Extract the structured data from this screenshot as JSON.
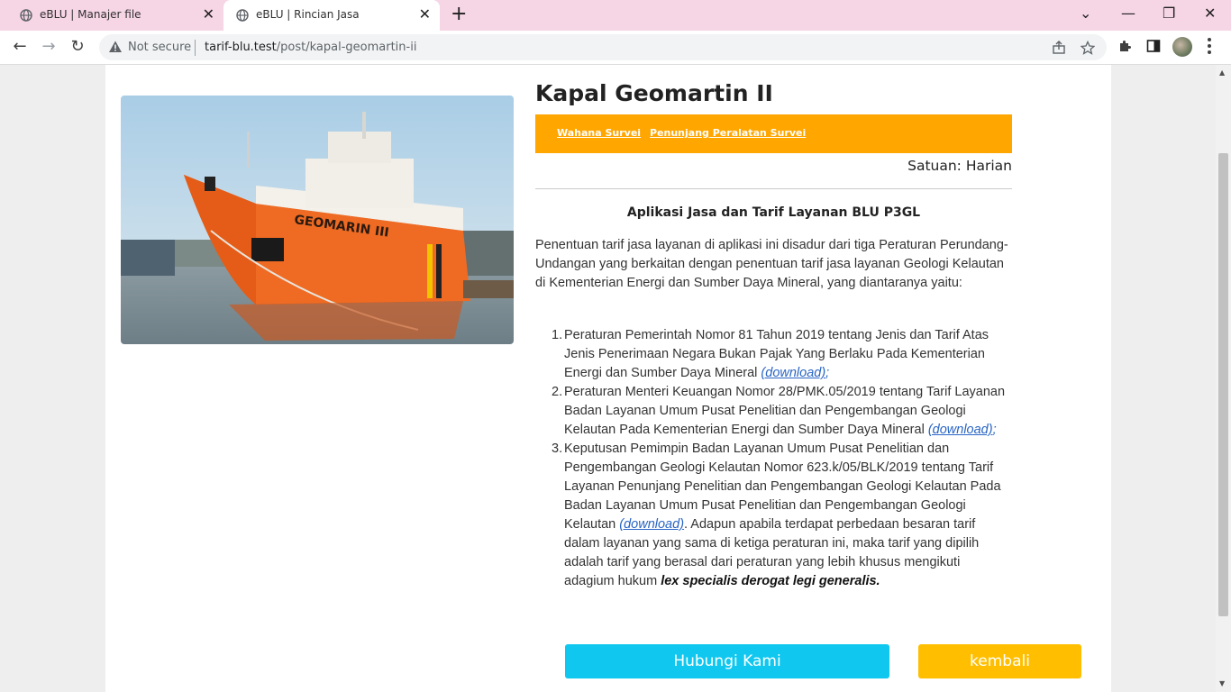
{
  "browser": {
    "tabs": [
      {
        "title": "eBLU | Manajer file",
        "active": false
      },
      {
        "title": "eBLU | Rincian Jasa",
        "active": true
      }
    ],
    "security_label": "Not secure",
    "url_host": "tarif-blu.test",
    "url_path": "/post/kapal-geomartin-ii"
  },
  "post": {
    "title": "Kapal Geomartin II",
    "image_alt": "GEOMARIN III",
    "categories": [
      "Wahana Survei",
      "Penunjang Peralatan Survei"
    ],
    "unit_label": "Satuan: Harian"
  },
  "info": {
    "heading": "Aplikasi Jasa dan Tarif Layanan BLU P3GL",
    "intro": "Penentuan tarif jasa layanan di aplikasi ini disadur dari tiga Peraturan Perundang-Undangan yang berkaitan dengan penentuan tarif jasa layanan Geologi Kelautan di Kementerian Energi dan Sumber Daya Mineral, yang diantaranya yaitu:",
    "regulations": [
      {
        "num": "1.",
        "text": "Peraturan Pemerintah Nomor 81 Tahun 2019 tentang Jenis dan Tarif Atas Jenis Penerimaan Negara Bukan Pajak Yang Berlaku Pada Kementerian Energi dan Sumber Daya Mineral ",
        "link": "(download)",
        "after": ";"
      },
      {
        "num": "2.",
        "text": "Peraturan Menteri Keuangan Nomor 28/PMK.05/2019 tentang Tarif Layanan Badan Layanan Umum Pusat Penelitian dan Pengembangan Geologi Kelautan Pada Kementerian Energi dan Sumber Daya Mineral ",
        "link": "(download)",
        "after": ";"
      },
      {
        "num": "3.",
        "text": "Keputusan Pemimpin Badan Layanan Umum Pusat Penelitian dan Pengembangan Geologi Kelautan Nomor 623.k/05/BLK/2019 tentang Tarif Layanan Penunjang Penelitian dan Pengembangan Geologi Kelautan Pada Badan Layanan Umum Pusat Penelitian dan Pengembangan Geologi Kelautan ",
        "link": "(download)",
        "after": ". Adapun apabila terdapat perbedaan besaran tarif dalam layanan yang sama di ketiga peraturan ini, maka tarif yang dipilih adalah tarif yang berasal dari peraturan yang lebih khusus mengikuti adagium hukum ",
        "emphasis": "lex specialis derogat legi generalis."
      }
    ]
  },
  "actions": {
    "contact_label": "Hubungi Kami",
    "back_label": "kembali"
  },
  "colors": {
    "tabbar": "#f6d5e5",
    "category_bar": "#ffa600",
    "contact_button": "#10c8ef",
    "back_button": "#ffbf00",
    "link": "#2965c4"
  }
}
